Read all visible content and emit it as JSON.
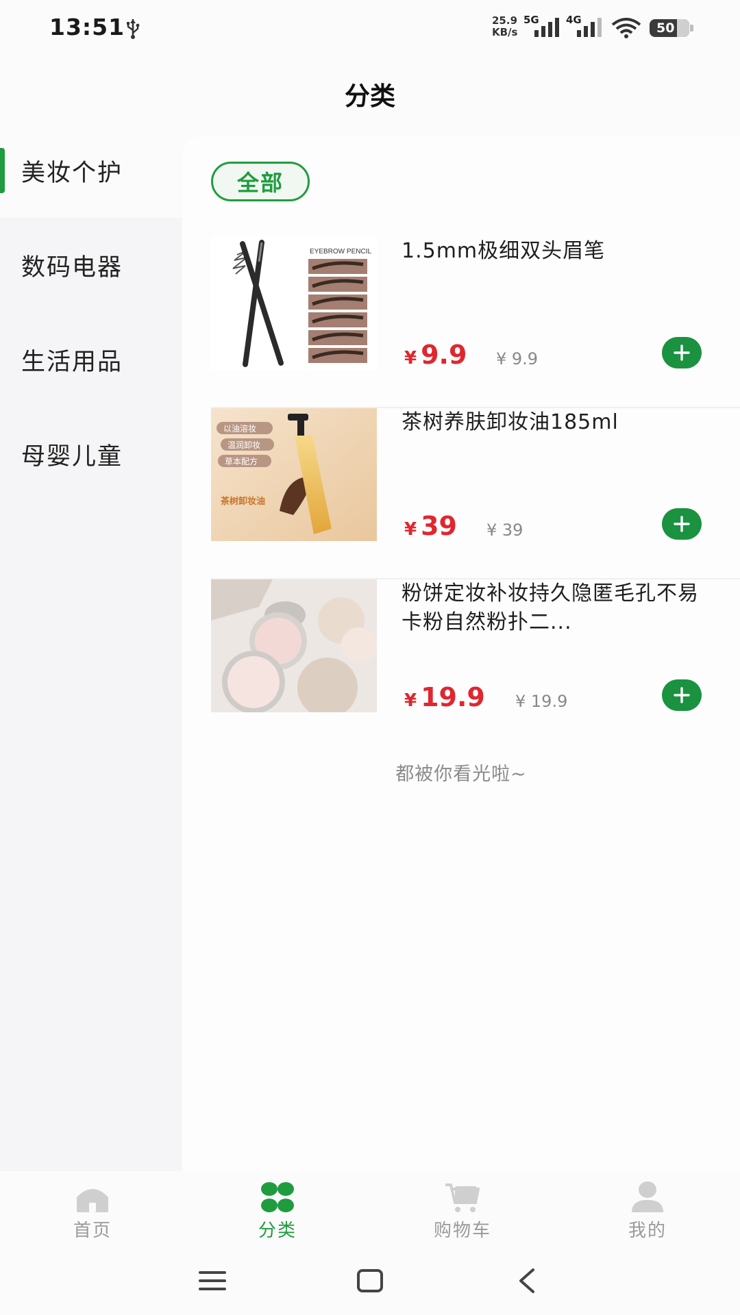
{
  "status_bar": {
    "time": "13:51",
    "net_speed_value": "25.9",
    "net_speed_unit": "KB/s",
    "sim1_label": "5G",
    "sim2_label": "4G",
    "battery": "50",
    "icons": [
      "usb-icon",
      "signal-5g-icon",
      "signal-4g-icon",
      "wifi-icon",
      "battery-icon"
    ]
  },
  "header": {
    "title": "分类"
  },
  "sidebar": {
    "items": [
      {
        "label": "美妆个护",
        "active": true
      },
      {
        "label": "数码电器",
        "active": false
      },
      {
        "label": "生活用品",
        "active": false
      },
      {
        "label": "母婴儿童",
        "active": false
      }
    ]
  },
  "content": {
    "filter_chip": "全部",
    "products": [
      {
        "title": "1.5mm极细双头眉笔",
        "currency": "¥",
        "price": "9.9",
        "original_price": "¥ 9.9",
        "image_text": "EYEBROW PENCIL"
      },
      {
        "title": "茶树养肤卸妆油185ml",
        "currency": "¥",
        "price": "39",
        "original_price": "¥ 39",
        "image_tags": [
          "以油溶妆",
          "温润卸妆",
          "草本配方"
        ],
        "image_caption": "茶树卸妆油"
      },
      {
        "title": "粉饼定妆补妆持久隐匿毛孔不易卡粉自然粉扑二...",
        "currency": "¥",
        "price": "19.9",
        "original_price": "¥ 19.9"
      }
    ],
    "end_note": "都被你看光啦~"
  },
  "tabbar": {
    "tabs": [
      {
        "label": "首页",
        "icon": "home-icon",
        "active": false
      },
      {
        "label": "分类",
        "icon": "category-icon",
        "active": true
      },
      {
        "label": "购物车",
        "icon": "cart-icon",
        "active": false
      },
      {
        "label": "我的",
        "icon": "user-icon",
        "active": false
      }
    ]
  },
  "navbar": {
    "icons": [
      "menu-icon",
      "home-square-icon",
      "back-icon"
    ]
  },
  "colors": {
    "accent": "#1f9c3e",
    "price": "#e0262f",
    "add_button": "#1a9240",
    "sidebar_bg": "#f5f5f7"
  }
}
